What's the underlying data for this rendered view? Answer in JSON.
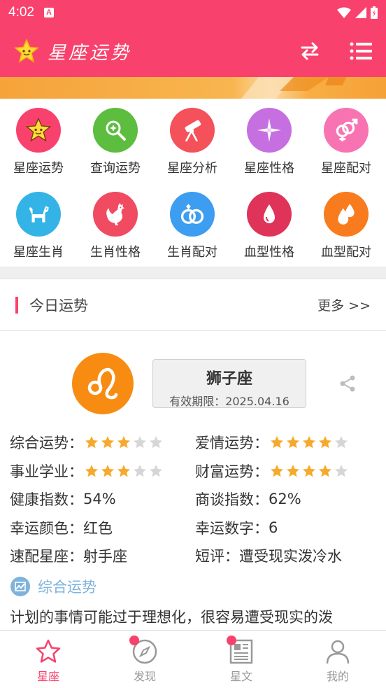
{
  "status_bar": {
    "time": "4:02",
    "notification_glyph": "A"
  },
  "app_bar": {
    "title": "星座运势",
    "logo_icon": "star-face-icon",
    "swap_icon": "swap-arrows-icon",
    "menu_icon": "list-menu-icon"
  },
  "grid": {
    "items": [
      {
        "label": "星座运势",
        "color": "#f8426d",
        "icon": "star-face-icon"
      },
      {
        "label": "查询运势",
        "color": "#5cbd3f",
        "icon": "magnifier-icon"
      },
      {
        "label": "星座分析",
        "color": "#f4515a",
        "icon": "telescope-icon"
      },
      {
        "label": "星座性格",
        "color": "#c66fe0",
        "icon": "sparkle-icon"
      },
      {
        "label": "星座配对",
        "color": "#f873b2",
        "icon": "gender-pair-icon"
      },
      {
        "label": "星座生肖",
        "color": "#34b4e6",
        "icon": "dog-icon"
      },
      {
        "label": "生肖性格",
        "color": "#f04b60",
        "icon": "rooster-icon"
      },
      {
        "label": "生肖配对",
        "color": "#3d9df0",
        "icon": "rings-icon"
      },
      {
        "label": "血型性格",
        "color": "#e0335a",
        "icon": "blood-drop-icon"
      },
      {
        "label": "血型配对",
        "color": "#f87b1d",
        "icon": "double-drop-icon"
      }
    ]
  },
  "today": {
    "title": "今日运势",
    "more": "更多 >>",
    "sign": {
      "name": "狮子座",
      "valid": "有效期限：2025.04.16",
      "symbol": "leo-symbol-icon",
      "color": "#f88c12"
    },
    "rows": [
      [
        {
          "key": "综合运势：",
          "stars": 3,
          "max": 5
        },
        {
          "key": "爱情运势：",
          "stars": 4,
          "max": 5
        }
      ],
      [
        {
          "key": "事业学业：",
          "stars": 3,
          "max": 5
        },
        {
          "key": "财富运势：",
          "stars": 4,
          "max": 5
        }
      ],
      [
        {
          "key": "健康指数：",
          "value": "54%"
        },
        {
          "key": "商谈指数：",
          "value": "62%"
        }
      ],
      [
        {
          "key": "幸运颜色：",
          "value": "红色"
        },
        {
          "key": "幸运数字：",
          "value": "6"
        }
      ],
      [
        {
          "key": "速配星座：",
          "value": "射手座"
        },
        {
          "key": "短评：",
          "value": "遭受现实泼冷水"
        }
      ]
    ],
    "section_title": "综合运势",
    "description": "计划的事情可能过于理想化，很容易遭受现实的泼"
  },
  "bottom_nav": {
    "items": [
      {
        "label": "星座",
        "icon": "star-outline-icon",
        "active": true,
        "badge": false
      },
      {
        "label": "发现",
        "icon": "compass-icon",
        "active": false,
        "badge": true
      },
      {
        "label": "星文",
        "icon": "newspaper-icon",
        "active": false,
        "badge": true
      },
      {
        "label": "我的",
        "icon": "person-icon",
        "active": false,
        "badge": false
      }
    ]
  },
  "colors": {
    "primary": "#f8426d",
    "star_on": "#f7a92c",
    "star_off": "#d6d6d6",
    "accent_blue": "#7db3dc"
  }
}
